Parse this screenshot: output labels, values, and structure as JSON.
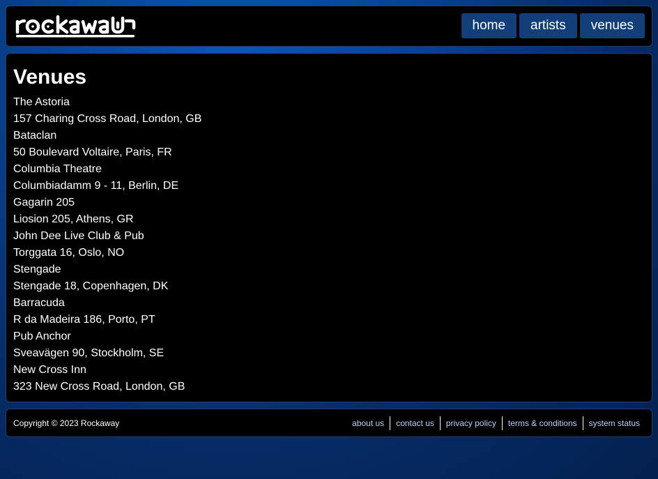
{
  "header": {
    "logo_text": "rockaway",
    "nav": [
      {
        "label": "home"
      },
      {
        "label": "artists"
      },
      {
        "label": "venues"
      }
    ]
  },
  "main": {
    "title": "Venues",
    "venues": [
      {
        "name": "The Astoria",
        "address": "157 Charing Cross Road, London, GB"
      },
      {
        "name": "Bataclan",
        "address": "50 Boulevard Voltaire, Paris, FR"
      },
      {
        "name": "Columbia Theatre",
        "address": "Columbiadamm 9 - 11, Berlin, DE"
      },
      {
        "name": "Gagarin 205",
        "address": "Liosion 205, Athens, GR"
      },
      {
        "name": "John Dee Live Club & Pub",
        "address": "Torggata 16, Oslo, NO"
      },
      {
        "name": "Stengade",
        "address": "Stengade 18, Copenhagen, DK"
      },
      {
        "name": "Barracuda",
        "address": "R da Madeira 186, Porto, PT"
      },
      {
        "name": "Pub Anchor",
        "address": "Sveavägen 90, Stockholm, SE"
      },
      {
        "name": "New Cross Inn",
        "address": "323 New Cross Road, London, GB"
      }
    ]
  },
  "footer": {
    "copyright": "Copyright © 2023 Rockaway",
    "links": [
      {
        "label": "about us"
      },
      {
        "label": "contact us"
      },
      {
        "label": "privacy policy"
      },
      {
        "label": "terms & conditions"
      },
      {
        "label": "system status"
      }
    ]
  },
  "colors": {
    "background": "#08408c",
    "panel": "#000000",
    "nav_button": "#123f78",
    "footer_link": "#b8d2ff"
  }
}
